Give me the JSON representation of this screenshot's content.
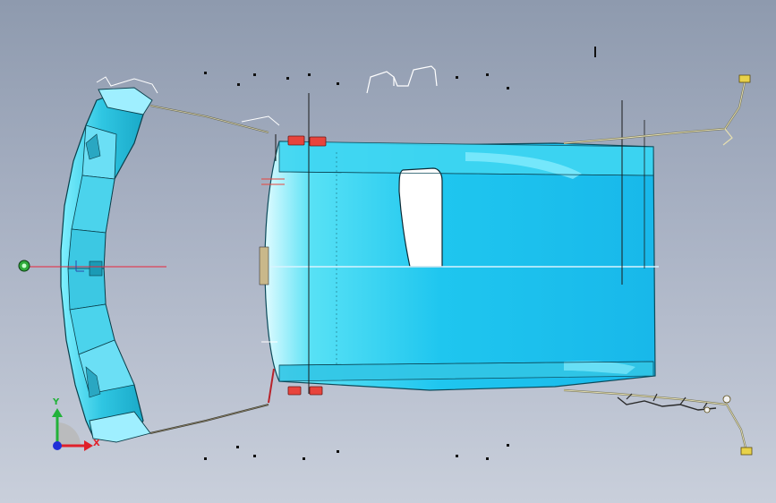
{
  "viewport": {
    "background_top": "#8e9aae",
    "background_bottom": "#c9cfdb"
  },
  "model": {
    "body_color": "#19c6f0",
    "body_highlight": "#bff6ff",
    "frame_color": "#35c9e6",
    "accent_red": "#e8443c",
    "cable_color": "#d8d2a8"
  },
  "triad": {
    "x_label": "X",
    "y_label": "Y",
    "x_color": "#e0202a",
    "y_color": "#22b23a",
    "z_color": "#2030d8"
  },
  "origin_marker": {
    "icon": "origin-marker-icon",
    "color": "#2faa3a"
  }
}
